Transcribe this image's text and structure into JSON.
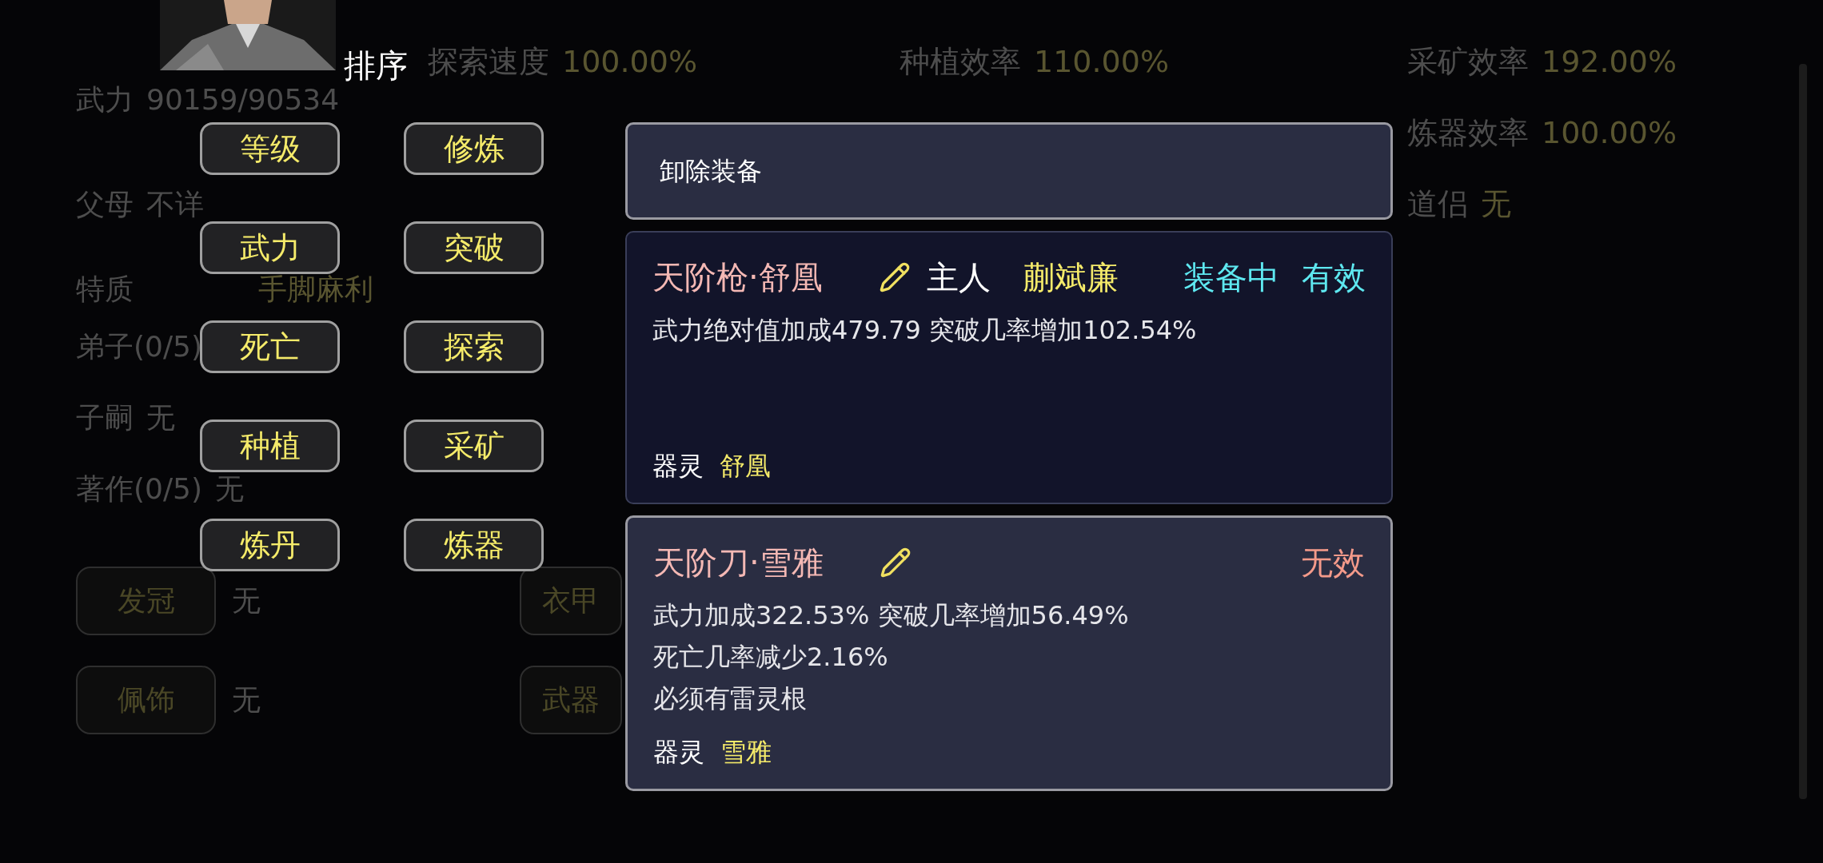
{
  "stats_left": [
    {
      "label": "武力",
      "value": "90159/90534"
    },
    {
      "label": "父母",
      "value": "不详"
    },
    {
      "label": "特质",
      "value": "手脚麻利"
    },
    {
      "label": "弟子(0/5)"
    },
    {
      "label": "子嗣",
      "value": "无"
    },
    {
      "label": "著作(0/5)",
      "value": "无"
    }
  ],
  "equipment_slots": [
    {
      "label": "发冠",
      "value": "无"
    },
    {
      "label": "衣甲"
    },
    {
      "label": "佩饰",
      "value": "无"
    },
    {
      "label": "武器"
    }
  ],
  "stats_right": [
    {
      "label": "探索速度",
      "value": "100.00%"
    },
    {
      "label": "种植效率",
      "value": "110.00%"
    },
    {
      "label": "采矿效率",
      "value": "192.00%"
    },
    {
      "label": "炼器效率",
      "value": "100.00%"
    },
    {
      "label": "道侣",
      "value": "无"
    }
  ],
  "sort_menu": {
    "title": "排序",
    "options": [
      "等级",
      "修炼",
      "武力",
      "突破",
      "死亡",
      "探索",
      "种植",
      "采矿",
      "炼丹",
      "炼器"
    ]
  },
  "equip_panel": {
    "unequip_button": "卸除装备",
    "items": [
      {
        "name": "天阶枪·舒凰",
        "owner_label": "主人",
        "owner": "蒯斌廉",
        "equipped": "装备中",
        "status": "有效",
        "valid": true,
        "effects": [
          "武力绝对值加成479.79 突破几率增加102.54%"
        ],
        "spirit_label": "器灵",
        "spirit": "舒凰"
      },
      {
        "name": "天阶刀·雪雅",
        "status": "无效",
        "valid": false,
        "effects": [
          "武力加成322.53% 突破几率增加56.49%",
          "死亡几率减少2.16%",
          "必须有雷灵根"
        ],
        "spirit_label": "器灵",
        "spirit": "雪雅"
      }
    ]
  }
}
